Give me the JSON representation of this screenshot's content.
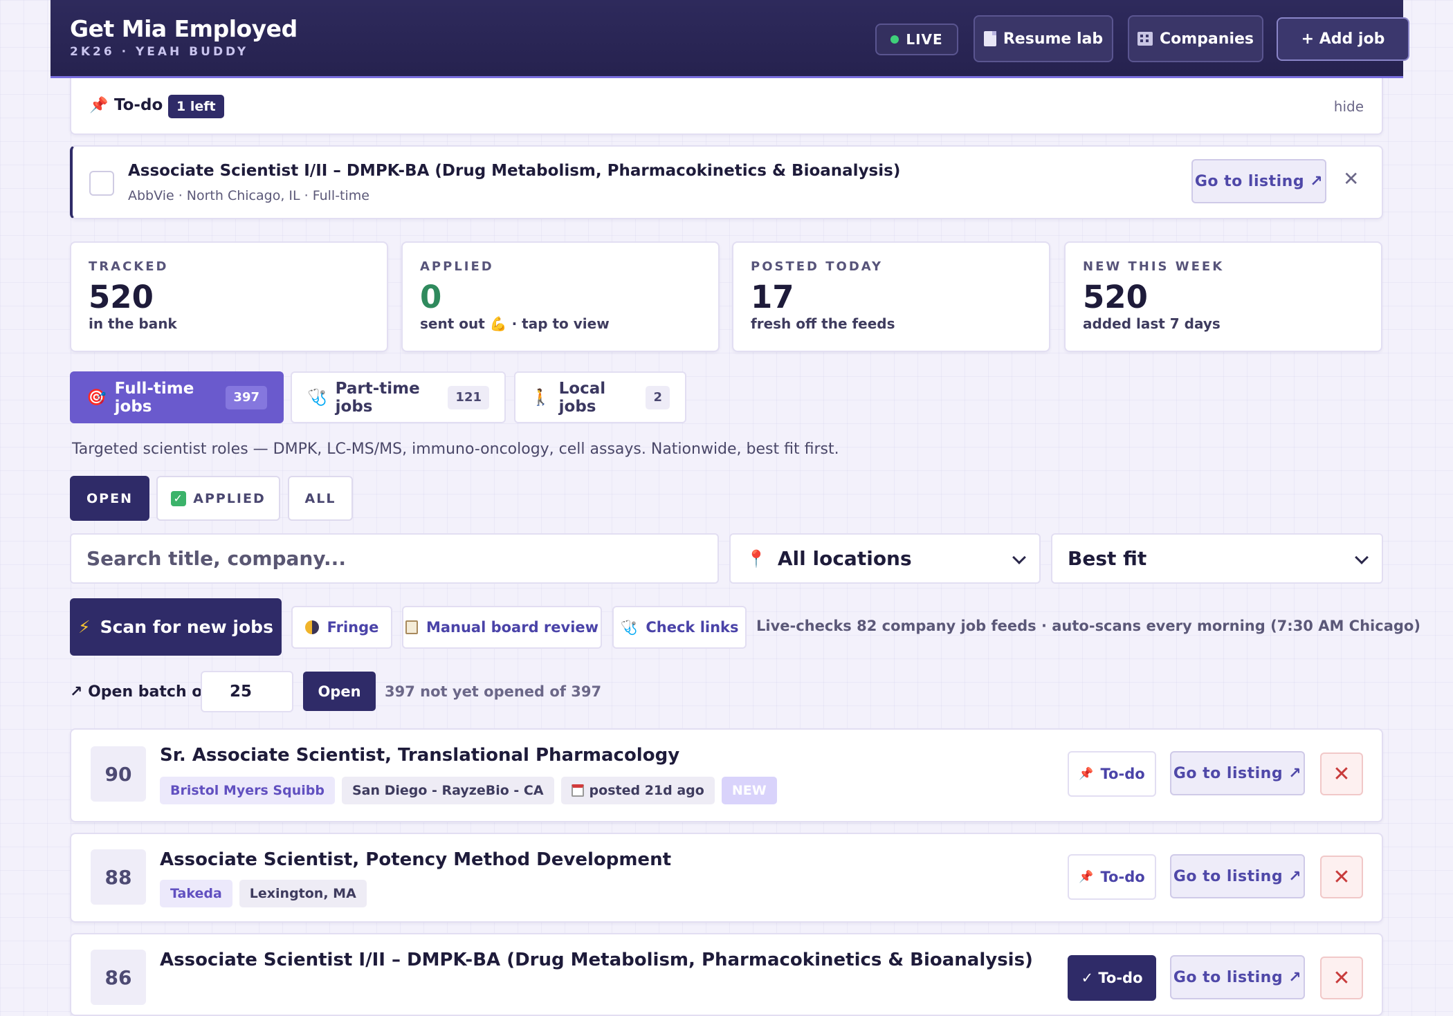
{
  "header": {
    "title": "Get Mia Employed",
    "subtitle": "2K26 · YEAH BUDDY",
    "live_label": "LIVE",
    "resume_label": "Resume lab",
    "companies_label": "Companies",
    "add_job_label": "+ Add job"
  },
  "todo": {
    "title": "To-do",
    "badge": "1 left",
    "hide_label": "hide",
    "items": [
      {
        "title": "Associate Scientist I/II – DMPK-BA (Drug Metabolism, Pharmacokinetics & Bioanalysis)",
        "meta": "AbbVie · North Chicago, IL · Full-time",
        "goto_label": "Go to listing ↗"
      }
    ]
  },
  "stats": [
    {
      "label": "TRACKED",
      "value": "520",
      "caption": "in the bank"
    },
    {
      "label": "APPLIED",
      "value": "0",
      "caption": "sent out 💪 · tap to view"
    },
    {
      "label": "POSTED TODAY",
      "value": "17",
      "caption": "fresh off the feeds"
    },
    {
      "label": "NEW THIS WEEK",
      "value": "520",
      "caption": "added last 7 days"
    }
  ],
  "job_tabs": [
    {
      "icon": "🎯",
      "label": "Full-time jobs",
      "count": "397"
    },
    {
      "icon": "🩺",
      "label": "Part-time jobs",
      "count": "121"
    },
    {
      "icon": "🚶",
      "label": "Local jobs",
      "count": "2"
    }
  ],
  "description": "Targeted scientist roles — DMPK, LC-MS/MS, immuno-oncology, cell assays. Nationwide, best fit first.",
  "status_filters": {
    "open": "OPEN",
    "applied": "APPLIED",
    "all": "ALL"
  },
  "search": {
    "placeholder": "Search title, company..."
  },
  "location_select": {
    "value": "All locations"
  },
  "sort_select": {
    "value": "Best fit"
  },
  "actions": {
    "scan_label": "Scan for new jobs",
    "fringe_label": "Fringe",
    "manual_label": "Manual board review",
    "check_links_label": "Check links",
    "note": "Live-checks 82 company job feeds · auto-scans every morning (7:30 AM Chicago)"
  },
  "batch": {
    "label": "Open batch of",
    "value": "25",
    "open_label": "Open",
    "note": "397 not yet opened of 397"
  },
  "jobs": [
    {
      "score": "90",
      "title": "Sr. Associate Scientist, Translational Pharmacology",
      "company": "Bristol Myers Squibb",
      "location": "San Diego - RayzeBio - CA",
      "posted": "posted 21d ago",
      "badge": "NEW",
      "todo_label": "To-do",
      "goto_label": "Go to listing ↗"
    },
    {
      "score": "88",
      "title": "Associate Scientist, Potency Method Development",
      "company": "Takeda",
      "location": "Lexington, MA",
      "todo_label": "To-do",
      "goto_label": "Go to listing ↗"
    },
    {
      "score": "86",
      "title": "Associate Scientist I/II – DMPK-BA (Drug Metabolism, Pharmacokinetics & Bioanalysis)",
      "todo_label": "✓ To-do",
      "goto_label": "Go to listing ↗"
    }
  ],
  "colors": {
    "header_bg": "#2e2a5c",
    "accent": "#6a5acd",
    "dark_button": "#2f2b68",
    "applied_green": "#2f8a5d",
    "danger": "#c83b3b"
  }
}
